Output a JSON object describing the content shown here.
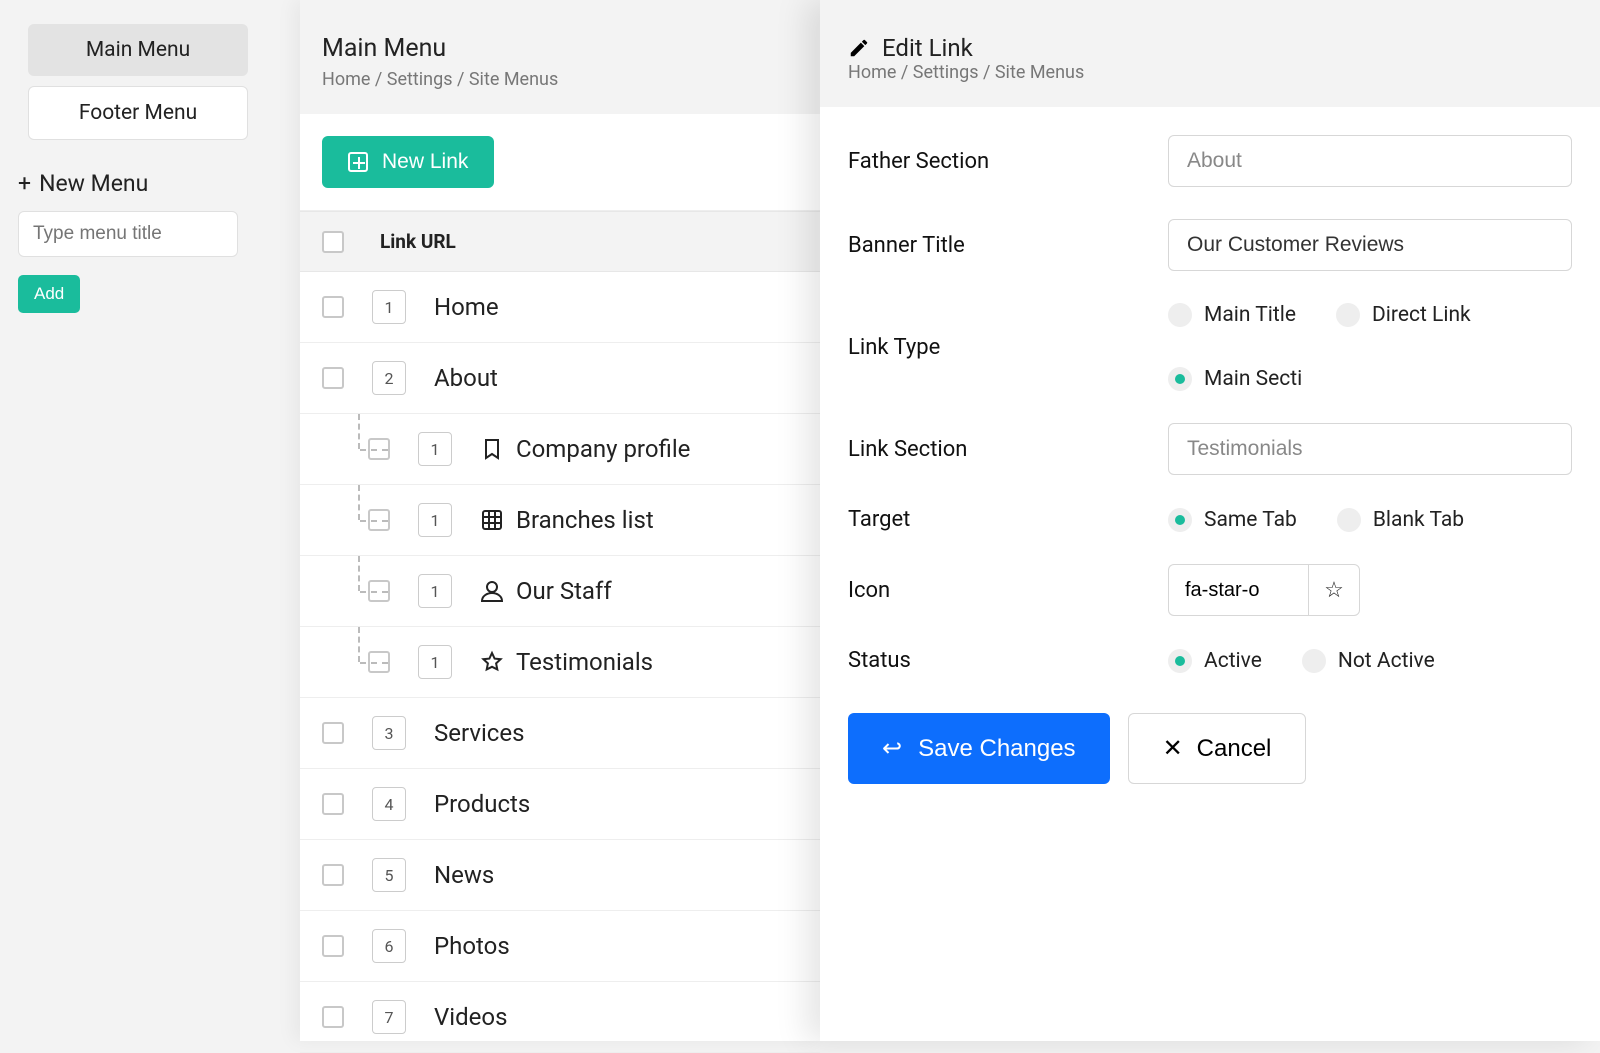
{
  "sidebar": {
    "menus": [
      {
        "label": "Main Menu",
        "active": true
      },
      {
        "label": "Footer Menu",
        "active": false
      }
    ],
    "new_menu_label": "New Menu",
    "menu_title_placeholder": "Type menu title",
    "add_label": "Add"
  },
  "mid": {
    "title": "Main Menu",
    "breadcrumb": "Home / Settings / Site Menus",
    "new_link_label": "New Link",
    "header_col": "Link URL",
    "rows": [
      {
        "order": "1",
        "label": "Home",
        "depth": 0,
        "icon": null
      },
      {
        "order": "2",
        "label": "About",
        "depth": 0,
        "icon": null
      },
      {
        "order": "1",
        "label": "Company profile",
        "depth": 1,
        "icon": "bookmark"
      },
      {
        "order": "1",
        "label": "Branches list",
        "depth": 1,
        "icon": "grid"
      },
      {
        "order": "1",
        "label": "Our Staff",
        "depth": 1,
        "icon": "user"
      },
      {
        "order": "1",
        "label": "Testimonials",
        "depth": 1,
        "icon": "star"
      },
      {
        "order": "3",
        "label": "Services",
        "depth": 0,
        "icon": null
      },
      {
        "order": "4",
        "label": "Products",
        "depth": 0,
        "icon": null
      },
      {
        "order": "5",
        "label": "News",
        "depth": 0,
        "icon": null
      },
      {
        "order": "6",
        "label": "Photos",
        "depth": 0,
        "icon": null
      },
      {
        "order": "7",
        "label": "Videos",
        "depth": 0,
        "icon": null
      }
    ]
  },
  "edit": {
    "title": "Edit Link",
    "breadcrumb": "Home / Settings / Site Menus",
    "labels": {
      "father_section": "Father Section",
      "banner_title": "Banner Title",
      "link_type": "Link Type",
      "link_section": "Link Section",
      "target": "Target",
      "icon": "Icon",
      "status": "Status"
    },
    "values": {
      "father_section": "About",
      "banner_title": "Our Customer Reviews",
      "link_section": "Testimonials",
      "icon_text": "fa-star-o"
    },
    "link_type_options": [
      {
        "label": "Main Title",
        "checked": false
      },
      {
        "label": "Direct Link",
        "checked": false
      },
      {
        "label": "Main Secti",
        "checked": true
      }
    ],
    "target_options": [
      {
        "label": "Same Tab",
        "checked": true
      },
      {
        "label": "Blank Tab",
        "checked": false
      }
    ],
    "status_options": [
      {
        "label": "Active",
        "checked": true
      },
      {
        "label": "Not Active",
        "checked": false
      }
    ],
    "save_label": "Save Changes",
    "cancel_label": "Cancel"
  }
}
